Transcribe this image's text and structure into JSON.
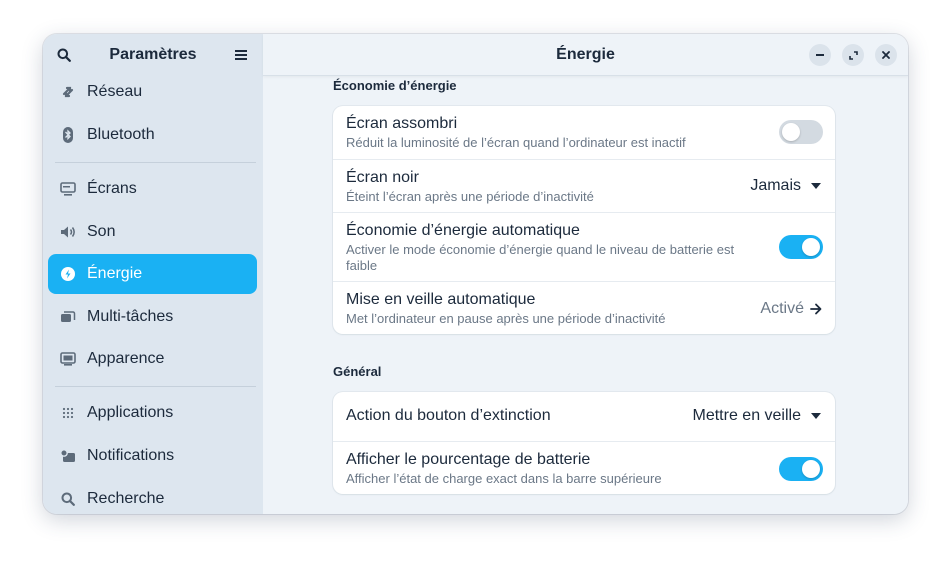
{
  "sidebar": {
    "title": "Paramètres",
    "search_icon": "search-icon",
    "menu_icon": "hamburger-menu-icon",
    "items": [
      {
        "label": "Réseau",
        "icon": "network-icon"
      },
      {
        "label": "Bluetooth",
        "icon": "bluetooth-icon"
      },
      {
        "label": "Écrans",
        "icon": "display-icon"
      },
      {
        "label": "Son",
        "icon": "speaker-icon"
      },
      {
        "label": "Énergie",
        "icon": "power-icon",
        "active": true
      },
      {
        "label": "Multi-tâches",
        "icon": "multitasking-icon"
      },
      {
        "label": "Apparence",
        "icon": "appearance-icon"
      },
      {
        "label": "Applications",
        "icon": "apps-grid-icon"
      },
      {
        "label": "Notifications",
        "icon": "notifications-icon"
      },
      {
        "label": "Recherche",
        "icon": "search-icon"
      }
    ]
  },
  "content": {
    "title": "Énergie",
    "window_controls": [
      "minimize-icon",
      "maximize-icon",
      "close-icon"
    ],
    "sections": [
      {
        "title": "Économie d’énergie",
        "rows": [
          {
            "title": "Écran assombri",
            "subtitle": "Réduit la luminosité de l’écran quand l’ordinateur est inactif",
            "toggle": false
          },
          {
            "title": "Écran noir",
            "subtitle": "Éteint l’écran après une période d’inactivité",
            "value": "Jamais"
          },
          {
            "title": "Économie d’énergie automatique",
            "subtitle_line1": "Activer le mode économie d’énergie quand le niveau de batterie est",
            "subtitle_line2": "faible",
            "toggle": true
          },
          {
            "title": "Mise en veille automatique",
            "subtitle": "Met l’ordinateur en pause après une période d’inactivité",
            "value": "Activé"
          }
        ]
      },
      {
        "title": "Général",
        "rows": [
          {
            "title": "Action du bouton d’extinction",
            "value": "Mettre en veille"
          },
          {
            "title": "Afficher le pourcentage de batterie",
            "subtitle": "Afficher l’état de charge exact dans la barre supérieure",
            "toggle": true
          }
        ]
      }
    ]
  },
  "colors": {
    "accent": "#1ab1f3",
    "sidebar_bg": "#dde6ef",
    "content_bg": "#eef3f8",
    "text": "#1c2a3c",
    "subtext": "#6b7887"
  }
}
